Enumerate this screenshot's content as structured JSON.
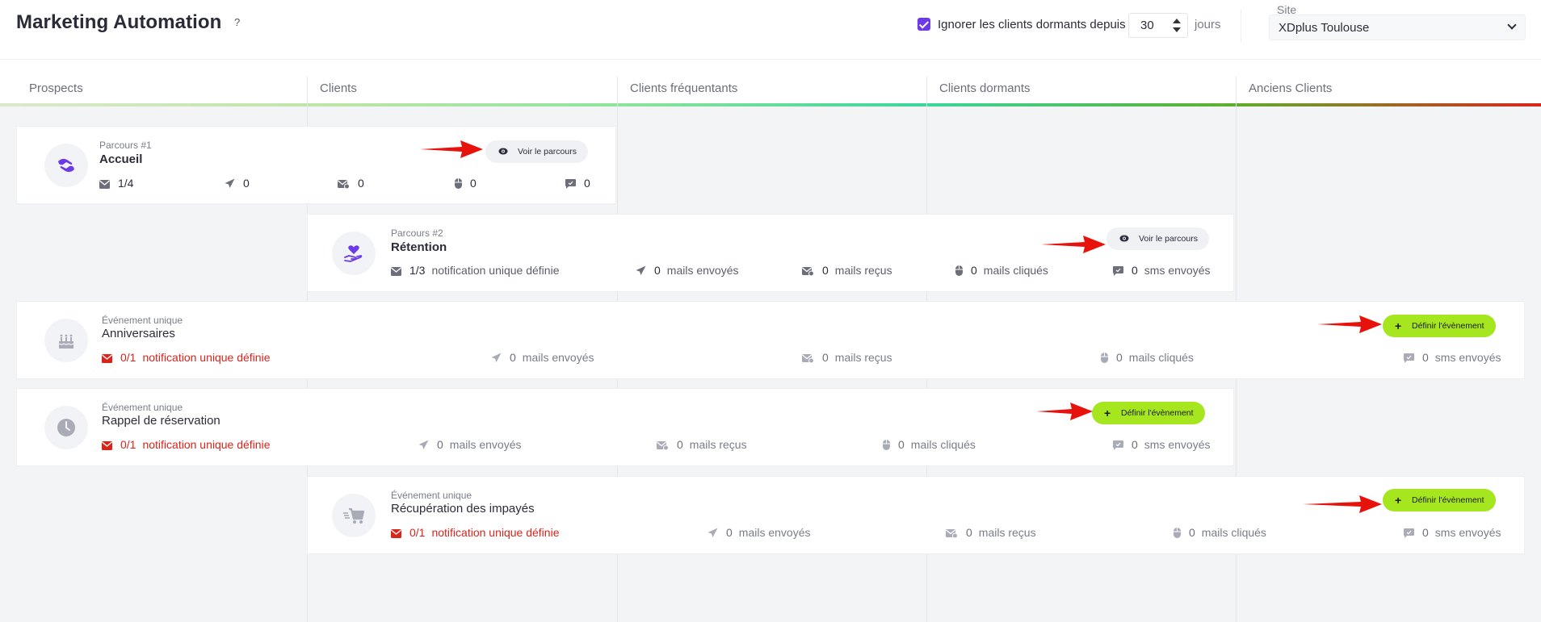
{
  "header": {
    "title": "Marketing Automation",
    "help": "?",
    "ignore_checkbox_checked": true,
    "ignore_label": "Ignorer les clients dormants depuis",
    "days_value": "30",
    "days_unit": "jours",
    "site_label": "Site",
    "site_value": "XDplus Toulouse"
  },
  "columns": [
    {
      "label": "Prospects",
      "color": "#c6e0b4"
    },
    {
      "label": "Clients",
      "color": "#9be38f"
    },
    {
      "label": "Clients fréquentants",
      "color": "#4cd69a"
    },
    {
      "label": "Clients dormants",
      "color": "#6bbd36"
    },
    {
      "label": "Anciens Clients",
      "color": "#d4322a"
    }
  ],
  "cards": [
    {
      "kicker": "Parcours #1",
      "title": "Accueil",
      "button": "Voir le parcours",
      "stats": [
        {
          "icon": "envelope-icon",
          "num": "1/4",
          "text": ""
        },
        {
          "icon": "paper-plane-icon",
          "num": "0",
          "text": ""
        },
        {
          "icon": "envelope-check-icon",
          "num": "0",
          "text": ""
        },
        {
          "icon": "mouse-icon",
          "num": "0",
          "text": ""
        },
        {
          "icon": "comment-icon",
          "num": "0",
          "text": ""
        }
      ]
    },
    {
      "kicker": "Parcours #2",
      "title": "Rétention",
      "button": "Voir le parcours",
      "stats": [
        {
          "icon": "envelope-icon",
          "num": "1/3",
          "text": "notification unique définie"
        },
        {
          "icon": "paper-plane-icon",
          "num": "0",
          "text": "mails envoyés"
        },
        {
          "icon": "envelope-check-icon",
          "num": "0",
          "text": "mails reçus"
        },
        {
          "icon": "mouse-icon",
          "num": "0",
          "text": "mails cliqués"
        },
        {
          "icon": "comment-icon",
          "num": "0",
          "text": "sms envoyés"
        }
      ]
    },
    {
      "kicker": "Événement unique",
      "title": "Anniversaires",
      "button": "Définir l'évènement",
      "stats": [
        {
          "icon": "envelope-icon",
          "num": "0/1",
          "text": "notification unique définie"
        },
        {
          "icon": "paper-plane-icon",
          "num": "0",
          "text": "mails envoyés"
        },
        {
          "icon": "envelope-check-icon",
          "num": "0",
          "text": "mails reçus"
        },
        {
          "icon": "mouse-icon",
          "num": "0",
          "text": "mails cliqués"
        },
        {
          "icon": "comment-icon",
          "num": "0",
          "text": "sms envoyés"
        }
      ]
    },
    {
      "kicker": "Événement unique",
      "title": "Rappel de réservation",
      "button": "Définir l'évènement",
      "stats": [
        {
          "icon": "envelope-icon",
          "num": "0/1",
          "text": "notification unique définie"
        },
        {
          "icon": "paper-plane-icon",
          "num": "0",
          "text": "mails envoyés"
        },
        {
          "icon": "envelope-check-icon",
          "num": "0",
          "text": "mails reçus"
        },
        {
          "icon": "mouse-icon",
          "num": "0",
          "text": "mails cliqués"
        },
        {
          "icon": "comment-icon",
          "num": "0",
          "text": "sms envoyés"
        }
      ]
    },
    {
      "kicker": "Événement unique",
      "title": "Récupération des impayés",
      "button": "Définir l'évènement",
      "stats": [
        {
          "icon": "envelope-icon",
          "num": "0/1",
          "text": "notification unique définie"
        },
        {
          "icon": "paper-plane-icon",
          "num": "0",
          "text": "mails envoyés"
        },
        {
          "icon": "envelope-check-icon",
          "num": "0",
          "text": "mails reçus"
        },
        {
          "icon": "mouse-icon",
          "num": "0",
          "text": "mails cliqués"
        },
        {
          "icon": "comment-icon",
          "num": "0",
          "text": "sms envoyés"
        }
      ]
    }
  ],
  "colors": {
    "accent": "#6d3ae8",
    "define_button": "#a6e61f",
    "alert_red": "#d9241c",
    "annotation_arrow": "#e8120c"
  }
}
